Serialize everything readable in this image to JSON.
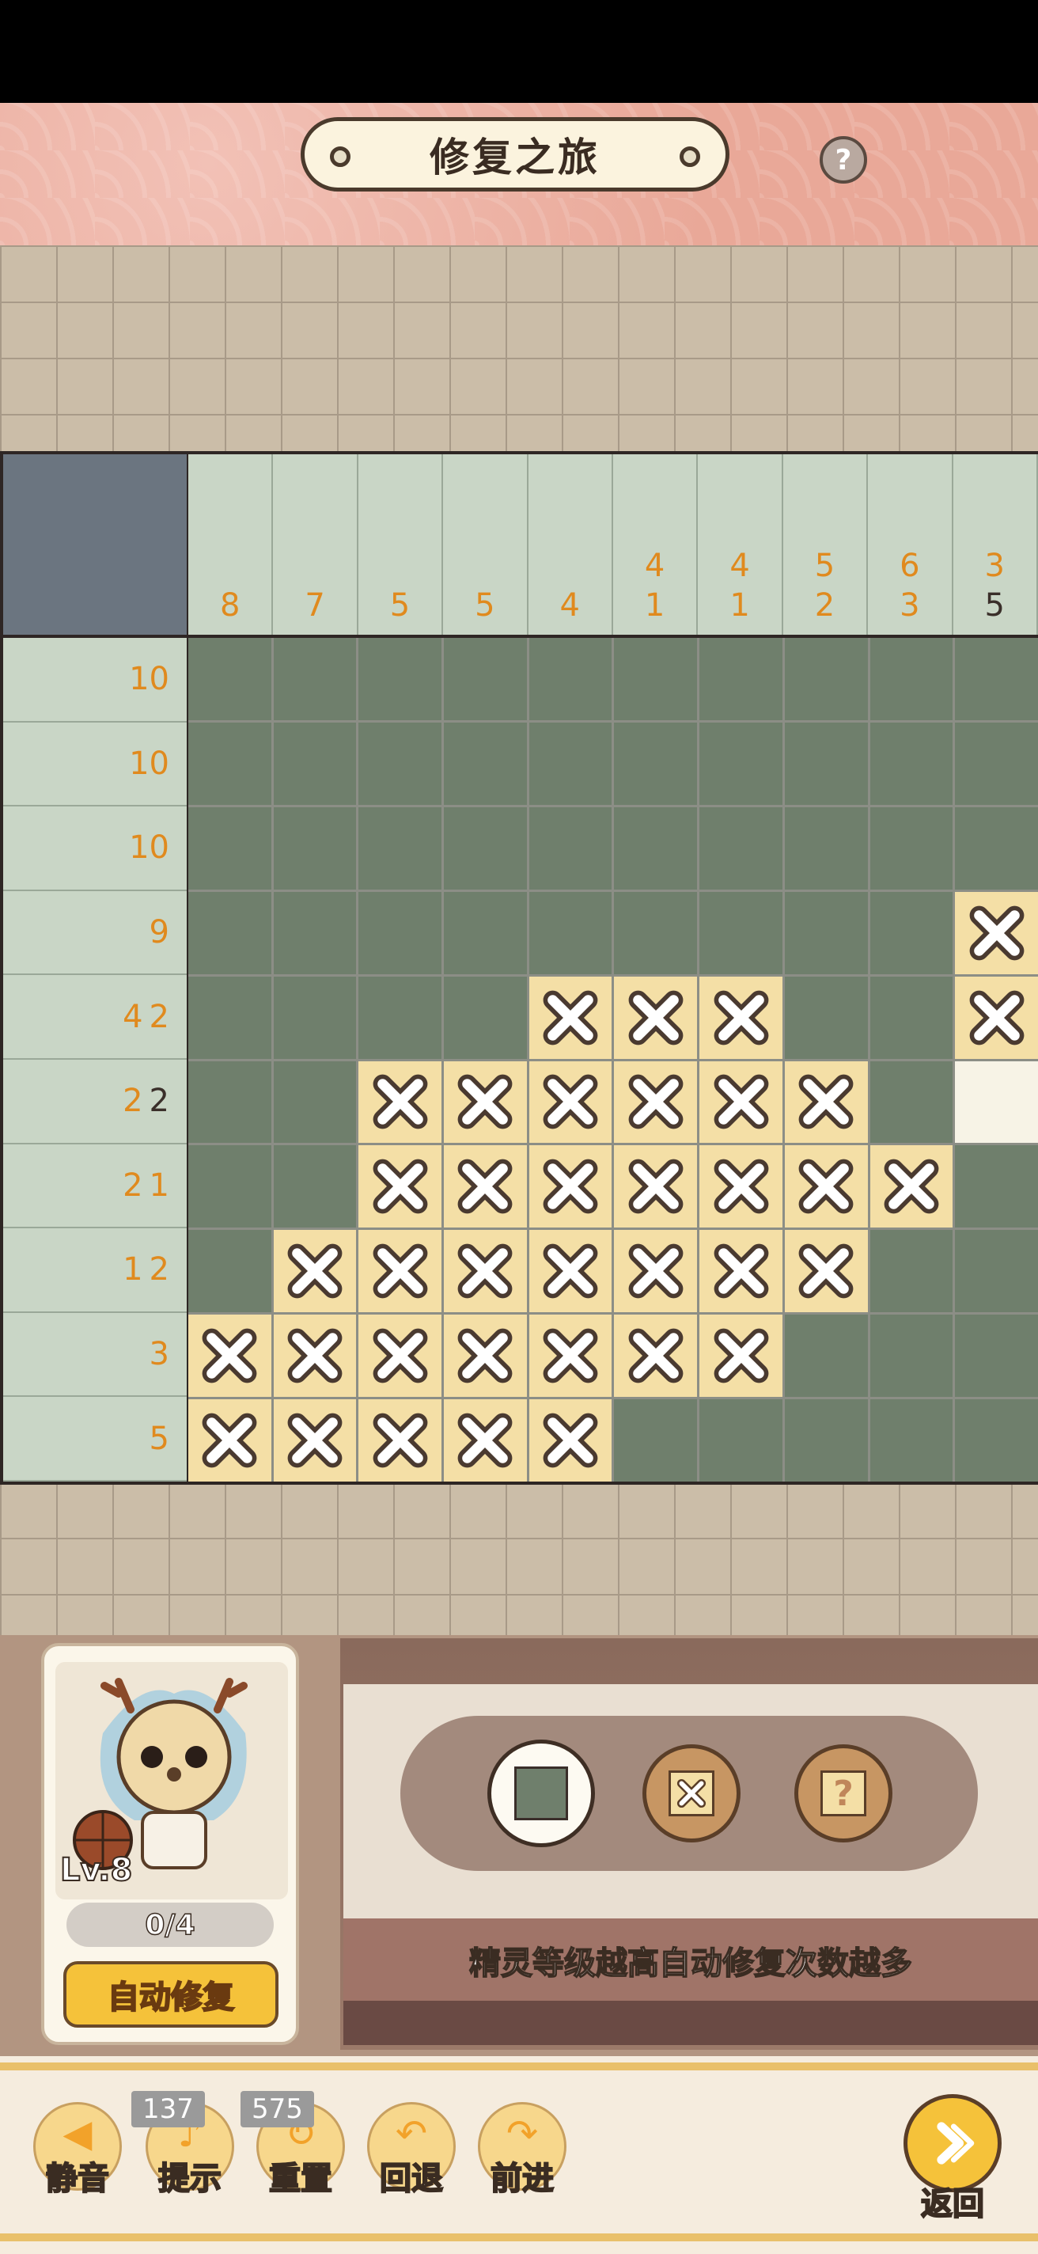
{
  "header": {
    "title": "修复之旅",
    "help_label": "?"
  },
  "puzzle": {
    "column_clues": [
      [
        {
          "n": "8",
          "done": false
        }
      ],
      [
        {
          "n": "7",
          "done": false
        }
      ],
      [
        {
          "n": "5",
          "done": false
        }
      ],
      [
        {
          "n": "5",
          "done": false
        }
      ],
      [
        {
          "n": "4",
          "done": false
        }
      ],
      [
        {
          "n": "4",
          "done": false
        },
        {
          "n": "1",
          "done": false
        }
      ],
      [
        {
          "n": "4",
          "done": false
        },
        {
          "n": "1",
          "done": false
        }
      ],
      [
        {
          "n": "5",
          "done": false
        },
        {
          "n": "2",
          "done": false
        }
      ],
      [
        {
          "n": "6",
          "done": false
        },
        {
          "n": "3",
          "done": false
        }
      ],
      [
        {
          "n": "3",
          "done": false
        },
        {
          "n": "5",
          "done": true
        }
      ]
    ],
    "row_clues": [
      [
        {
          "n": "10",
          "done": false
        }
      ],
      [
        {
          "n": "10",
          "done": false
        }
      ],
      [
        {
          "n": "10",
          "done": false
        }
      ],
      [
        {
          "n": "9",
          "done": false
        }
      ],
      [
        {
          "n": "4",
          "done": false
        },
        {
          "n": "2",
          "done": false
        }
      ],
      [
        {
          "n": "2",
          "done": false
        },
        {
          "n": "2",
          "done": true
        }
      ],
      [
        {
          "n": "2",
          "done": false
        },
        {
          "n": "1",
          "done": false
        }
      ],
      [
        {
          "n": "1",
          "done": false
        },
        {
          "n": "2",
          "done": false
        }
      ],
      [
        {
          "n": "3",
          "done": false
        }
      ],
      [
        {
          "n": "5",
          "done": false
        }
      ]
    ],
    "cells": [
      "FFFFFFFFFF",
      "FFFFFFFFFF",
      "FFFFFFFFFF",
      "FFFFFFFFFX",
      "FFFFXXXFFX",
      "FFXXXXXXFE",
      "FFXXXXXXXF",
      "FXXXXXXXFF",
      "XXXXXXXFFF",
      "XXXXXFFFFF"
    ],
    "legend": {
      "F": "filled",
      "X": "crossed",
      "E": "empty"
    }
  },
  "character": {
    "level": "Lv.8",
    "progress": "0/4",
    "auto_repair_label": "自动修复"
  },
  "modes": {
    "selected": "fill",
    "unknown_label": "?"
  },
  "hint_text": "精灵等级越高自动修复次数越多",
  "toolbar": {
    "mute_label": "静音",
    "hint_label": "提示",
    "hint_count": "137",
    "reset_label": "重置",
    "reset_count": "575",
    "undo_label": "回退",
    "redo_label": "前进",
    "back_label": "返回"
  },
  "colors": {
    "filled": "#6f7f6c",
    "crossed": "#f4dfa6",
    "clue": "#e08a1e",
    "accent": "#f5c23a"
  }
}
